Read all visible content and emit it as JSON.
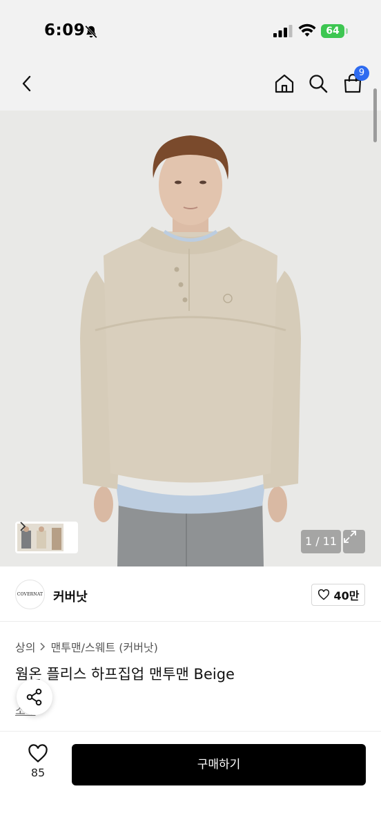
{
  "status_bar": {
    "time": "6:09",
    "battery_level": "64",
    "icons": [
      "bell-off-icon",
      "signal-icon",
      "wifi-icon",
      "battery-icon"
    ]
  },
  "nav": {
    "icons": [
      "chevron-left-icon",
      "home-icon",
      "search-icon",
      "shopping-bag-icon"
    ],
    "cart_badge": "9"
  },
  "gallery": {
    "counter": "1 / 11",
    "colors": {
      "background": "#e9e9e7",
      "sweater": "#d9cfbd",
      "shirt": "#bccde0",
      "pants": "#8f9294"
    }
  },
  "shop": {
    "logo_text": "COVERNAT",
    "name": "커버낫",
    "follow_count": "40만"
  },
  "breadcrumb": {
    "category": "상의",
    "subcategory": "맨투맨/스웨트 (커버낫)"
  },
  "product": {
    "title": "웜온 플리스 하프집업 맨투맨 Beige",
    "sub_link": "소개"
  },
  "bottom_bar": {
    "like_count": "85",
    "buy_label": "구매하기",
    "colors": {
      "buy_button": "#000000"
    }
  }
}
